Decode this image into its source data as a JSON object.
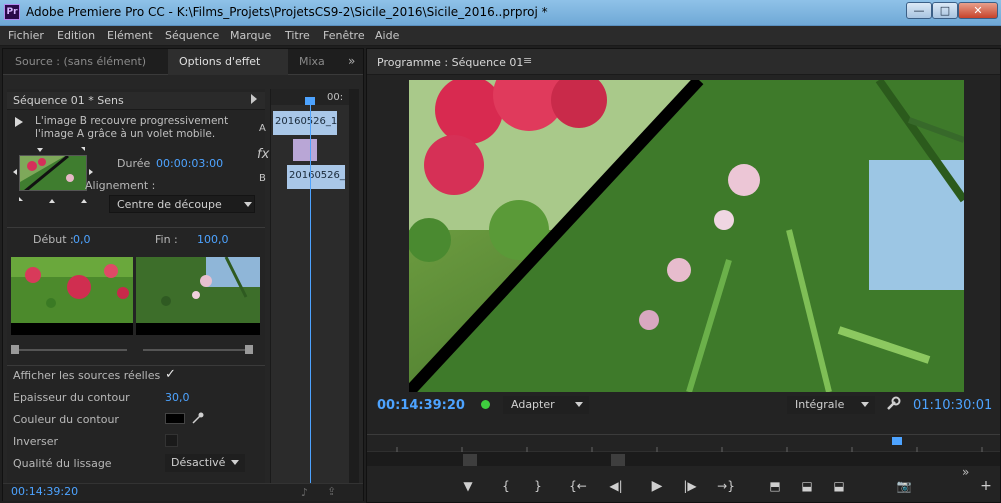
{
  "window": {
    "app_badge": "Pr",
    "title": "Adobe Premiere Pro CC - K:\\Films_Projets\\ProjetsCS9-2\\Sicile_2016\\Sicile_2016..prproj *",
    "minimize": "—",
    "maximize": "□",
    "close": "✕"
  },
  "menu": [
    "Fichier",
    "Edition",
    "Elément",
    "Séquence",
    "Marque",
    "Titre",
    "Fenêtre",
    "Aide"
  ],
  "left_panel": {
    "tabs": [
      "Source : (sans élément)",
      "Options d'effet",
      "Mixa"
    ],
    "active_tab": "Options d'effet",
    "overflow": "»",
    "sequence_header": "Séquence 01 * Sens",
    "description": "L'image B recouvre progressivement l'image A grâce à un volet mobile.",
    "duree_label": "Durée",
    "duree_value": "00:00:03:00",
    "alignement_label": "Alignement :",
    "alignement_value": "Centre de découpe",
    "debut_label": "Début :",
    "debut_value": "0,0",
    "fin_label": "Fin :",
    "fin_value": "100,0",
    "afficher_label": "Afficher les sources réelles",
    "afficher_check": "✓",
    "epaisseur_label": "Epaisseur du contour",
    "epaisseur_value": "30,0",
    "couleur_label": "Couleur du contour",
    "inverser_label": "Inverser",
    "qualite_label": "Qualité du lissage",
    "qualite_value": "Désactivé",
    "status_timecode": "00:14:39:20",
    "fx": "fx",
    "mini_timeline": {
      "time": "00:",
      "track_a": "A",
      "track_b": "B",
      "clip_a": "20160526_1",
      "clip_b": "20160526_"
    }
  },
  "program": {
    "title": "Programme : Séquence 01",
    "menu_icon": "≡",
    "timecode_current": "00:14:39:20",
    "fit": "Adapter",
    "resolution": "Intégrale",
    "timecode_duration": "01:10:30:01"
  },
  "controls": {
    "marker": "▼",
    "in": "{",
    "out": "}",
    "goto_in": "{←",
    "step_back": "◀|",
    "play": "▶",
    "step_forward": "|▶",
    "goto_out": "→}",
    "insert": "⬒",
    "overwrite": "⬓",
    "export_frame": "📷",
    "add": "+"
  },
  "colors": {
    "accent": "#4da3ff",
    "green_dot": "#3fcf3f"
  }
}
